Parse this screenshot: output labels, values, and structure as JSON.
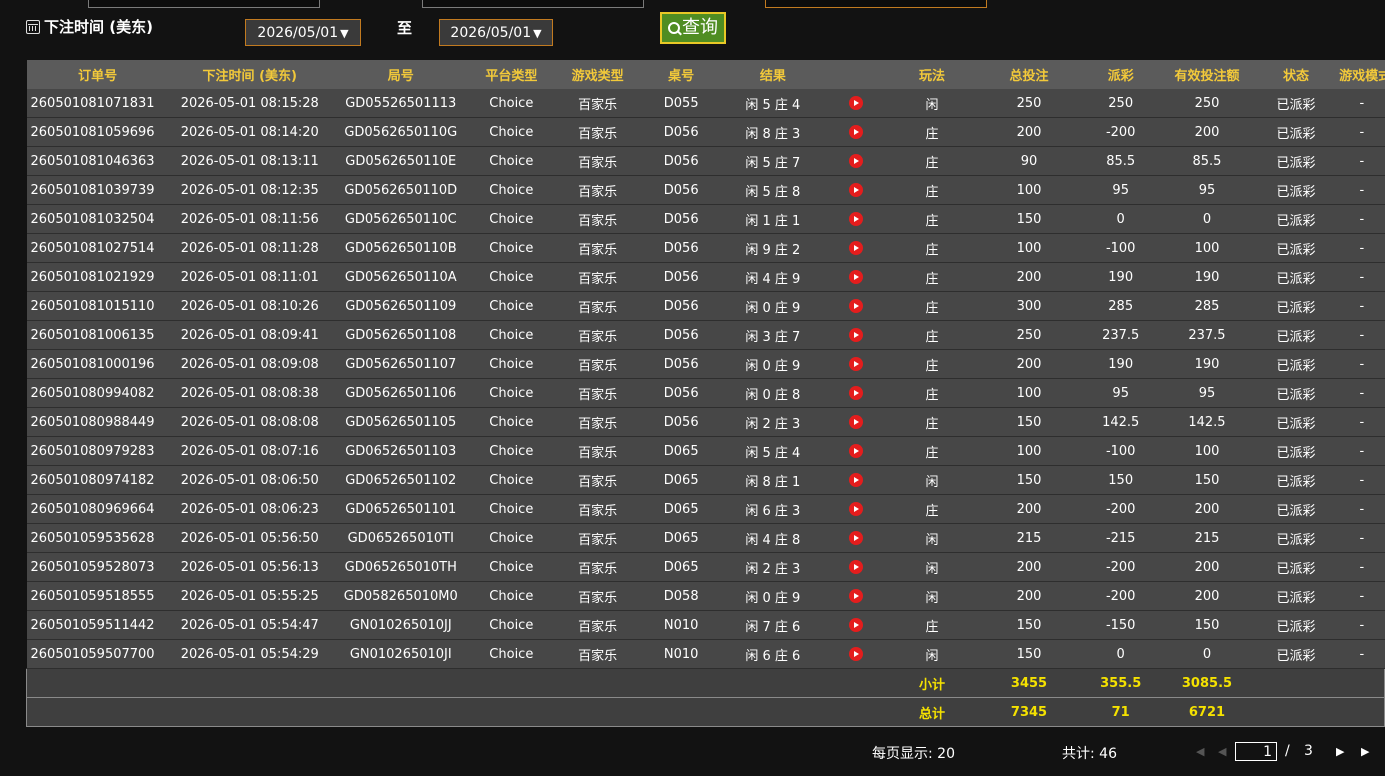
{
  "filter": {
    "label": "下注时间 (美东)",
    "start_date": "2026/05/01",
    "end_date": "2026/05/01",
    "to_label": "至",
    "query_label": "查询"
  },
  "table": {
    "headers": [
      "订单号",
      "下注时间 (美东)",
      "局号",
      "平台类型",
      "游戏类型",
      "桌号",
      "结果",
      "",
      "玩法",
      "总投注",
      "派彩",
      "有效投注额",
      "状态",
      "游戏模式"
    ],
    "rows": [
      {
        "order_id": "260501081071831",
        "bet_time": "2026-05-01 08:15:28",
        "round_id": "GD05526501113",
        "platform": "Choice",
        "game_type": "百家乐",
        "table_no": "D055",
        "result": "闲 5 庄 4",
        "play": "闲",
        "total_bet": "250",
        "payout": "250",
        "payout_color": "red",
        "valid_bet": "250",
        "status": "已派彩",
        "game_mode": "-"
      },
      {
        "order_id": "260501081059696",
        "bet_time": "2026-05-01 08:14:20",
        "round_id": "GD0562650110G",
        "platform": "Choice",
        "game_type": "百家乐",
        "table_no": "D056",
        "result": "闲 8 庄 3",
        "play": "庄",
        "total_bet": "200",
        "payout": "-200",
        "payout_color": "green",
        "valid_bet": "200",
        "status": "已派彩",
        "game_mode": "-"
      },
      {
        "order_id": "260501081046363",
        "bet_time": "2026-05-01 08:13:11",
        "round_id": "GD0562650110E",
        "platform": "Choice",
        "game_type": "百家乐",
        "table_no": "D056",
        "result": "闲 5 庄 7",
        "play": "庄",
        "total_bet": "90",
        "payout": "85.5",
        "payout_color": "red",
        "valid_bet": "85.5",
        "status": "已派彩",
        "game_mode": "-"
      },
      {
        "order_id": "260501081039739",
        "bet_time": "2026-05-01 08:12:35",
        "round_id": "GD0562650110D",
        "platform": "Choice",
        "game_type": "百家乐",
        "table_no": "D056",
        "result": "闲 5 庄 8",
        "play": "庄",
        "total_bet": "100",
        "payout": "95",
        "payout_color": "red",
        "valid_bet": "95",
        "status": "已派彩",
        "game_mode": "-"
      },
      {
        "order_id": "260501081032504",
        "bet_time": "2026-05-01 08:11:56",
        "round_id": "GD0562650110C",
        "platform": "Choice",
        "game_type": "百家乐",
        "table_no": "D056",
        "result": "闲 1 庄 1",
        "play": "庄",
        "total_bet": "150",
        "payout": "0",
        "payout_color": "white",
        "valid_bet": "0",
        "status": "已派彩",
        "game_mode": "-"
      },
      {
        "order_id": "260501081027514",
        "bet_time": "2026-05-01 08:11:28",
        "round_id": "GD0562650110B",
        "platform": "Choice",
        "game_type": "百家乐",
        "table_no": "D056",
        "result": "闲 9 庄 2",
        "play": "庄",
        "total_bet": "100",
        "payout": "-100",
        "payout_color": "green",
        "valid_bet": "100",
        "status": "已派彩",
        "game_mode": "-"
      },
      {
        "order_id": "260501081021929",
        "bet_time": "2026-05-01 08:11:01",
        "round_id": "GD0562650110A",
        "platform": "Choice",
        "game_type": "百家乐",
        "table_no": "D056",
        "result": "闲 4 庄 9",
        "play": "庄",
        "total_bet": "200",
        "payout": "190",
        "payout_color": "red",
        "valid_bet": "190",
        "status": "已派彩",
        "game_mode": "-"
      },
      {
        "order_id": "260501081015110",
        "bet_time": "2026-05-01 08:10:26",
        "round_id": "GD05626501109",
        "platform": "Choice",
        "game_type": "百家乐",
        "table_no": "D056",
        "result": "闲 0 庄 9",
        "play": "庄",
        "total_bet": "300",
        "payout": "285",
        "payout_color": "red",
        "valid_bet": "285",
        "status": "已派彩",
        "game_mode": "-"
      },
      {
        "order_id": "260501081006135",
        "bet_time": "2026-05-01 08:09:41",
        "round_id": "GD05626501108",
        "platform": "Choice",
        "game_type": "百家乐",
        "table_no": "D056",
        "result": "闲 3 庄 7",
        "play": "庄",
        "total_bet": "250",
        "payout": "237.5",
        "payout_color": "red",
        "valid_bet": "237.5",
        "status": "已派彩",
        "game_mode": "-"
      },
      {
        "order_id": "260501081000196",
        "bet_time": "2026-05-01 08:09:08",
        "round_id": "GD05626501107",
        "platform": "Choice",
        "game_type": "百家乐",
        "table_no": "D056",
        "result": "闲 0 庄 9",
        "play": "庄",
        "total_bet": "200",
        "payout": "190",
        "payout_color": "red",
        "valid_bet": "190",
        "status": "已派彩",
        "game_mode": "-"
      },
      {
        "order_id": "260501080994082",
        "bet_time": "2026-05-01 08:08:38",
        "round_id": "GD05626501106",
        "platform": "Choice",
        "game_type": "百家乐",
        "table_no": "D056",
        "result": "闲 0 庄 8",
        "play": "庄",
        "total_bet": "100",
        "payout": "95",
        "payout_color": "red",
        "valid_bet": "95",
        "status": "已派彩",
        "game_mode": "-"
      },
      {
        "order_id": "260501080988449",
        "bet_time": "2026-05-01 08:08:08",
        "round_id": "GD05626501105",
        "platform": "Choice",
        "game_type": "百家乐",
        "table_no": "D056",
        "result": "闲 2 庄 3",
        "play": "庄",
        "total_bet": "150",
        "payout": "142.5",
        "payout_color": "red",
        "valid_bet": "142.5",
        "status": "已派彩",
        "game_mode": "-"
      },
      {
        "order_id": "260501080979283",
        "bet_time": "2026-05-01 08:07:16",
        "round_id": "GD06526501103",
        "platform": "Choice",
        "game_type": "百家乐",
        "table_no": "D065",
        "result": "闲 5 庄 4",
        "play": "庄",
        "total_bet": "100",
        "payout": "-100",
        "payout_color": "green",
        "valid_bet": "100",
        "status": "已派彩",
        "game_mode": "-"
      },
      {
        "order_id": "260501080974182",
        "bet_time": "2026-05-01 08:06:50",
        "round_id": "GD06526501102",
        "platform": "Choice",
        "game_type": "百家乐",
        "table_no": "D065",
        "result": "闲 8 庄 1",
        "play": "闲",
        "total_bet": "150",
        "payout": "150",
        "payout_color": "red",
        "valid_bet": "150",
        "status": "已派彩",
        "game_mode": "-"
      },
      {
        "order_id": "260501080969664",
        "bet_time": "2026-05-01 08:06:23",
        "round_id": "GD06526501101",
        "platform": "Choice",
        "game_type": "百家乐",
        "table_no": "D065",
        "result": "闲 6 庄 3",
        "play": "庄",
        "total_bet": "200",
        "payout": "-200",
        "payout_color": "green",
        "valid_bet": "200",
        "status": "已派彩",
        "game_mode": "-"
      },
      {
        "order_id": "260501059535628",
        "bet_time": "2026-05-01 05:56:50",
        "round_id": "GD065265010TI",
        "platform": "Choice",
        "game_type": "百家乐",
        "table_no": "D065",
        "result": "闲 4 庄 8",
        "play": "闲",
        "total_bet": "215",
        "payout": "-215",
        "payout_color": "green",
        "valid_bet": "215",
        "status": "已派彩",
        "game_mode": "-"
      },
      {
        "order_id": "260501059528073",
        "bet_time": "2026-05-01 05:56:13",
        "round_id": "GD065265010TH",
        "platform": "Choice",
        "game_type": "百家乐",
        "table_no": "D065",
        "result": "闲 2 庄 3",
        "play": "闲",
        "total_bet": "200",
        "payout": "-200",
        "payout_color": "green",
        "valid_bet": "200",
        "status": "已派彩",
        "game_mode": "-"
      },
      {
        "order_id": "260501059518555",
        "bet_time": "2026-05-01 05:55:25",
        "round_id": "GD058265010M0",
        "platform": "Choice",
        "game_type": "百家乐",
        "table_no": "D058",
        "result": "闲 0 庄 9",
        "play": "闲",
        "total_bet": "200",
        "payout": "-200",
        "payout_color": "green",
        "valid_bet": "200",
        "status": "已派彩",
        "game_mode": "-"
      },
      {
        "order_id": "260501059511442",
        "bet_time": "2026-05-01 05:54:47",
        "round_id": "GN010265010JJ",
        "platform": "Choice",
        "game_type": "百家乐",
        "table_no": "N010",
        "result": "闲 7 庄 6",
        "play": "庄",
        "total_bet": "150",
        "payout": "-150",
        "payout_color": "green",
        "valid_bet": "150",
        "status": "已派彩",
        "game_mode": "-"
      },
      {
        "order_id": "260501059507700",
        "bet_time": "2026-05-01 05:54:29",
        "round_id": "GN010265010JI",
        "platform": "Choice",
        "game_type": "百家乐",
        "table_no": "N010",
        "result": "闲 6 庄 6",
        "play": "闲",
        "total_bet": "150",
        "payout": "0",
        "payout_color": "white",
        "valid_bet": "0",
        "status": "已派彩",
        "game_mode": "-"
      }
    ],
    "subtotal": {
      "label": "小计",
      "total_bet": "3455",
      "payout": "355.5",
      "valid_bet": "3085.5"
    },
    "total": {
      "label": "总计",
      "total_bet": "7345",
      "payout": "71",
      "valid_bet": "6721"
    }
  },
  "pagination": {
    "per_page_label": "每页显示: 20",
    "total_label": "共计: 46",
    "current_page": "1",
    "separator": "/",
    "total_pages": "3"
  },
  "colors": {
    "header_text": "#f2c93a",
    "sum_text": "#f5e200",
    "payout_red": "#e02020",
    "payout_green": "#3fd62f",
    "date_border": "#c17a20",
    "query_bg": "#4f8d22"
  }
}
